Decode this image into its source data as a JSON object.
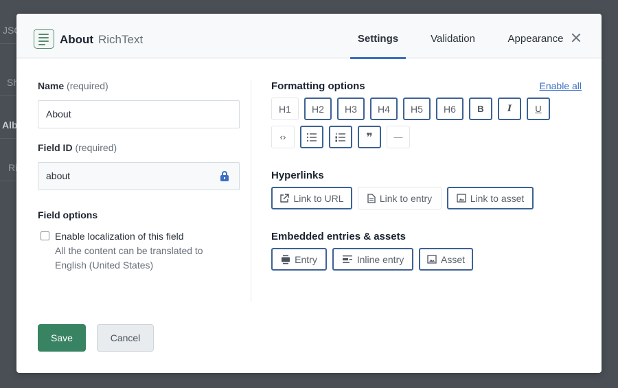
{
  "background": {
    "fragments": [
      "JSO",
      "Sh",
      "Alb",
      "Ri"
    ]
  },
  "modal": {
    "title": "About",
    "subtitle": "RichText",
    "icon": "rich-text-icon",
    "tabs": [
      {
        "label": "Settings",
        "active": true
      },
      {
        "label": "Validation",
        "active": false
      },
      {
        "label": "Appearance",
        "active": false
      }
    ],
    "close_icon": "close-icon"
  },
  "left": {
    "name_label": "Name",
    "name_required": "(required)",
    "name_value": "About",
    "fieldid_label": "Field ID",
    "fieldid_required": "(required)",
    "fieldid_value": "about",
    "field_options_title": "Field options",
    "localization_label": "Enable localization of this field",
    "localization_help_1": "All the content can be translated to",
    "localization_help_2": "English (United States)",
    "localization_checked": false
  },
  "right": {
    "formatting": {
      "title": "Formatting options",
      "enable_all": "Enable all",
      "row1": [
        {
          "label": "H1",
          "enabled": false
        },
        {
          "label": "H2",
          "enabled": true
        },
        {
          "label": "H3",
          "enabled": true
        },
        {
          "label": "H4",
          "enabled": true
        },
        {
          "label": "H5",
          "enabled": true
        },
        {
          "label": "H6",
          "enabled": true
        },
        {
          "label": "B",
          "icon": "bold-icon",
          "enabled": true
        },
        {
          "label": "I",
          "icon": "italic-icon",
          "enabled": true
        },
        {
          "label": "U",
          "icon": "underline-icon",
          "enabled": true
        }
      ],
      "row2": [
        {
          "label": "‹›",
          "icon": "code-icon",
          "enabled": false
        },
        {
          "label": "☰",
          "icon": "bulleted-list-icon",
          "enabled": true
        },
        {
          "label": "☰",
          "icon": "numbered-list-icon",
          "enabled": true
        },
        {
          "label": "❞",
          "icon": "quote-icon",
          "enabled": true
        },
        {
          "label": "—",
          "icon": "horizontal-rule-icon",
          "enabled": false
        }
      ]
    },
    "hyperlinks": {
      "title": "Hyperlinks",
      "buttons": [
        {
          "label": "Link to URL",
          "icon": "external-link-icon",
          "enabled": true
        },
        {
          "label": "Link to entry",
          "icon": "document-icon",
          "enabled": false
        },
        {
          "label": "Link to asset",
          "icon": "image-icon",
          "enabled": true
        }
      ]
    },
    "embedded": {
      "title": "Embedded entries & assets",
      "buttons": [
        {
          "label": "Entry",
          "icon": "entry-block-icon",
          "enabled": true
        },
        {
          "label": "Inline entry",
          "icon": "inline-entry-icon",
          "enabled": true
        },
        {
          "label": "Asset",
          "icon": "image-icon",
          "enabled": true
        }
      ]
    }
  },
  "footer": {
    "save_label": "Save",
    "cancel_label": "Cancel"
  },
  "colors": {
    "accent_blue": "#3c6fc4",
    "toggle_border": "#3d6294",
    "save_green": "#388361",
    "overlay": "#4a4f56"
  }
}
